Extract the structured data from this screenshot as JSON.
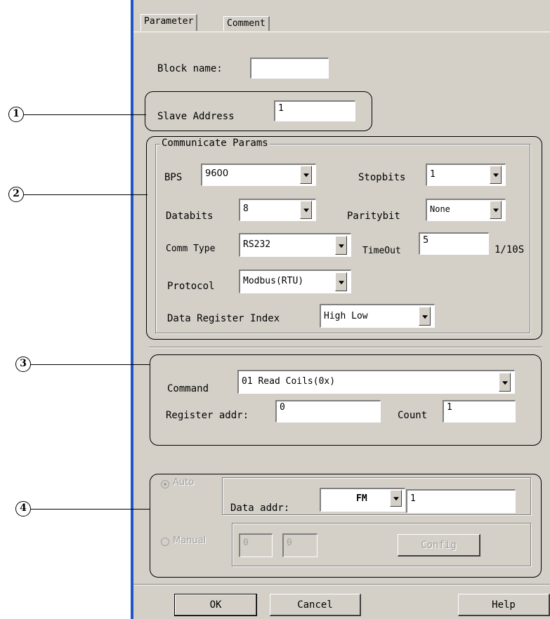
{
  "tabs": [
    {
      "label": "Parameter",
      "active": true
    },
    {
      "label": "Comment",
      "active": false
    }
  ],
  "block_name": {
    "label": "Block name:",
    "value": ""
  },
  "slave_address": {
    "label": "Slave Address",
    "value": "1"
  },
  "communicate_params": {
    "title": "Communicate Params",
    "bps": {
      "label": "BPS",
      "value": "9600"
    },
    "stopbits": {
      "label": "Stopbits",
      "value": "1"
    },
    "databits": {
      "label": "Databits",
      "value": "8"
    },
    "paritybit": {
      "label": "Paritybit",
      "value": "None"
    },
    "comm_type": {
      "label": "Comm Type",
      "value": "RS232"
    },
    "timeout": {
      "label": "TimeOut",
      "value": "5",
      "unit": "1/10S"
    },
    "protocol": {
      "label": "Protocol",
      "value": "Modbus(RTU)"
    },
    "data_register_index": {
      "label": "Data Register Index",
      "value": "High Low"
    }
  },
  "command_group": {
    "command": {
      "label": "Command",
      "value": "01 Read Coils(0x)"
    },
    "register_addr": {
      "label": "Register addr:",
      "value": "0"
    },
    "count": {
      "label": "Count",
      "value": "1"
    }
  },
  "data_group": {
    "auto": {
      "label": "Auto",
      "selected": true
    },
    "data_addr": {
      "label": "Data addr:",
      "type_value": "FM",
      "value": "1"
    },
    "manual": {
      "label": "Manual",
      "selected": false
    },
    "manual_field_1": "0",
    "manual_field_2": "0",
    "config_button": "Config"
  },
  "buttons": {
    "ok": "OK",
    "cancel": "Cancel",
    "help": "Help"
  },
  "markers": [
    "1",
    "2",
    "3",
    "4"
  ]
}
